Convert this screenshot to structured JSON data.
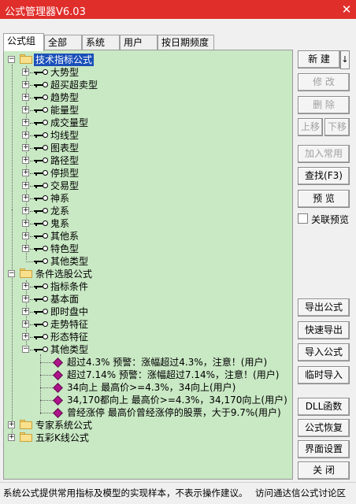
{
  "window": {
    "title": "公式管理器V6.03",
    "close_glyph": "✕"
  },
  "tabs": [
    "公式组",
    "全部",
    "系统",
    "用户",
    "按日期频度"
  ],
  "tree": {
    "expand_glyph": "+",
    "collapse_glyph": "−",
    "root1": {
      "label": "技术指标公式"
    },
    "root1_items": [
      "大势型",
      "超买超卖型",
      "趋势型",
      "能量型",
      "成交量型",
      "均线型",
      "图表型",
      "路径型",
      "停损型",
      "交易型",
      "神系",
      "龙系",
      "鬼系",
      "其他系",
      "特色型",
      "其他类型"
    ],
    "root2": {
      "label": "条件选股公式"
    },
    "root2_items": [
      "指标条件",
      "基本面",
      "即时盘中",
      "走势特征",
      "形态特征",
      "其他类型"
    ],
    "formulas": [
      "超过4.3%  预警：涨幅超过4.3%，注意！(用户)",
      "超过7.14%  预警：涨幅超过7.14%，注意！(用户)",
      "34向上  最高价>=4.3%，34向上(用户)",
      "34,170都向上  最高价>=4.3%，34,170向上(用户)",
      "曾经涨停  最高价曾经涨停的股票，大于9.7%(用户)"
    ],
    "root3": {
      "label": "专家系统公式"
    },
    "root4": {
      "label": "五彩K线公式"
    }
  },
  "buttons": {
    "new": "新 建",
    "new_arrow": "↓",
    "modify": "修 改",
    "delete": "删 除",
    "move_up": "上移",
    "move_down": "下移",
    "add_common": "加入常用",
    "find": "查找(F3)",
    "preview": "预 览",
    "linked_preview": "关联预览",
    "export": "导出公式",
    "quick_export": "快速导出",
    "import": "导入公式",
    "temp_import": "临时导入",
    "dll": "DLL函数",
    "restore": "公式恢复",
    "ui_settings": "界面设置",
    "close": "关 闭"
  },
  "footer": {
    "notice": "系统公式提供常用指标及模型的实现样本，不表示操作建议。",
    "forum_link": "访问通达信公式讨论区"
  }
}
